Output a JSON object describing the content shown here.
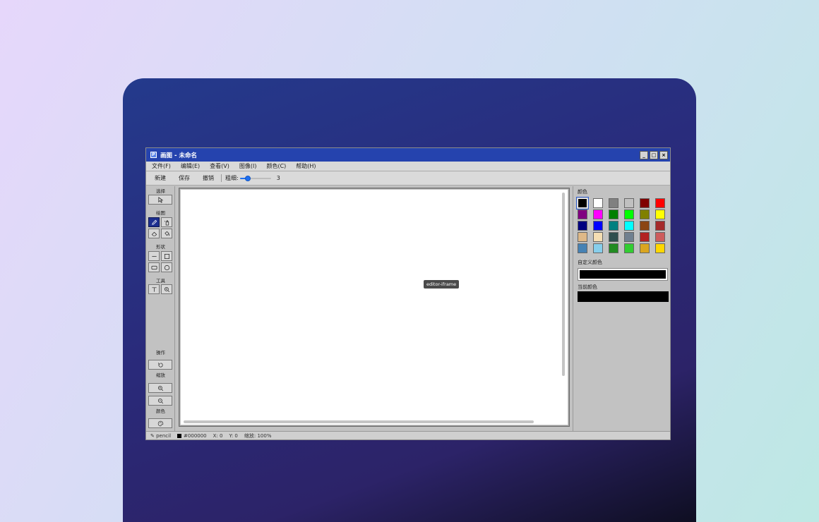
{
  "window": {
    "title": "画图 - 未命名",
    "icon_label": "P",
    "controls": {
      "minimize": "_",
      "maximize": "□",
      "close": "×"
    }
  },
  "menu": [
    "文件(F)",
    "编辑(E)",
    "查看(V)",
    "图像(I)",
    "颜色(C)",
    "帮助(H)"
  ],
  "toolbar": {
    "new_label": "新建",
    "save_label": "保存",
    "undo_label": "撤销",
    "thickness_label": "粗细:",
    "thickness_value": "3",
    "thickness_fraction": 0.2
  },
  "tools": {
    "select_label": "选择",
    "draw_label": "绘图",
    "shape_label": "形状",
    "utility_label": "工具",
    "operation_label": "操作",
    "zoom_label": "缩放",
    "color_label": "颜色",
    "icons": [
      "select-icon",
      "pencil-icon",
      "fill-bucket-icon",
      "eraser-icon",
      "paint-bucket-icon",
      "line-icon",
      "rectangle-icon",
      "rounded-rectangle-icon",
      "ellipse-icon",
      "text-icon",
      "magnifier-icon",
      "rotate-icon",
      "zoom-in-icon",
      "zoom-out-icon",
      "palette-icon"
    ],
    "active": "pencil"
  },
  "canvas": {
    "tooltip": "editor-iframe"
  },
  "palette": {
    "title": "颜色",
    "colors": [
      "#000000",
      "#ffffff",
      "#808080",
      "#c0c0c0",
      "#800000",
      "#ff0000",
      "#800080",
      "#ff00ff",
      "#008000",
      "#00ff00",
      "#808000",
      "#ffff00",
      "#000080",
      "#0000ff",
      "#008080",
      "#00ffff",
      "#8b4513",
      "#a52a2a",
      "#deb887",
      "#f5deb3",
      "#2f4f4f",
      "#708090",
      "#b22222",
      "#cd5c5c",
      "#4682b4",
      "#87ceeb",
      "#228b22",
      "#32cd32",
      "#daa520",
      "#ffd700"
    ],
    "selected_index": 0,
    "custom_label": "自定义颜色",
    "custom_color": "#000000",
    "current_label": "当前颜色",
    "current_color": "#000000"
  },
  "status": {
    "tool": "pencil",
    "color": "#000000",
    "x": "X: 0",
    "y": "Y: 0",
    "zoom": "缩放: 100%"
  }
}
